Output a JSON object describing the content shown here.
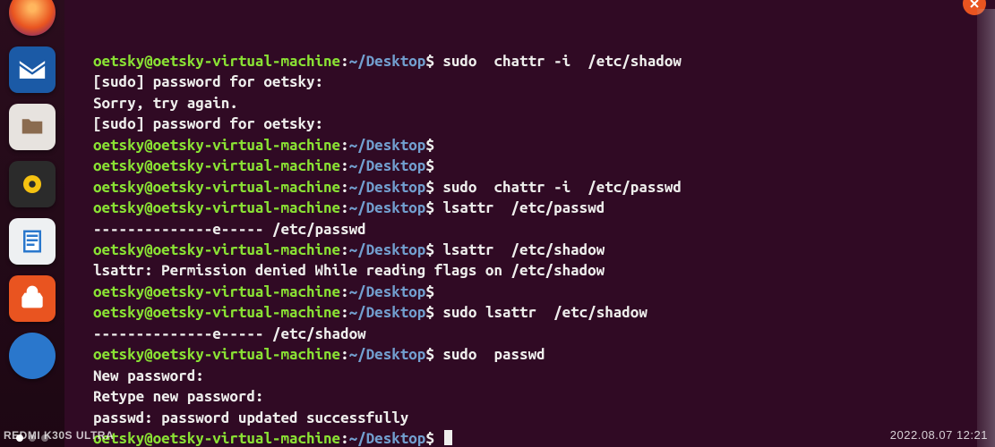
{
  "dock": {
    "items": [
      {
        "name": "firefox",
        "bg": "#e95420"
      },
      {
        "name": "thunderbird",
        "bg": "#1b5aa6"
      },
      {
        "name": "files",
        "bg": "#e7e3df"
      },
      {
        "name": "rhythmbox",
        "bg": "#2b2b2b"
      },
      {
        "name": "libreoffice-writer",
        "bg": "#eef0f2"
      },
      {
        "name": "ubuntu-software",
        "bg": "#e95420"
      },
      {
        "name": "help",
        "bg": "#2a77cc"
      }
    ]
  },
  "prompt": {
    "user_host": "oetsky@oetsky-virtual-machine",
    "colon": ":",
    "path": "~/Desktop",
    "dollar": "$"
  },
  "lines": [
    {
      "type": "prompt",
      "cmd": " sudo  chattr -i  /etc/shadow"
    },
    {
      "type": "out",
      "text": "[sudo] password for oetsky:"
    },
    {
      "type": "out",
      "text": "Sorry, try again."
    },
    {
      "type": "out",
      "text": "[sudo] password for oetsky:"
    },
    {
      "type": "prompt",
      "cmd": ""
    },
    {
      "type": "prompt",
      "cmd": ""
    },
    {
      "type": "prompt",
      "cmd": " sudo  chattr -i  /etc/passwd"
    },
    {
      "type": "prompt",
      "cmd": " lsattr  /etc/passwd"
    },
    {
      "type": "out",
      "text": "--------------e----- /etc/passwd"
    },
    {
      "type": "prompt",
      "cmd": " lsattr  /etc/shadow"
    },
    {
      "type": "out",
      "text": "lsattr: Permission denied While reading flags on /etc/shadow"
    },
    {
      "type": "prompt",
      "cmd": ""
    },
    {
      "type": "prompt",
      "cmd": " sudo lsattr  /etc/shadow"
    },
    {
      "type": "out",
      "text": "--------------e----- /etc/shadow"
    },
    {
      "type": "prompt",
      "cmd": " sudo  passwd"
    },
    {
      "type": "out",
      "text": "New password:"
    },
    {
      "type": "out",
      "text": "Retype new password:"
    },
    {
      "type": "out",
      "text": "passwd: password updated successfully"
    },
    {
      "type": "prompt",
      "cmd": " ",
      "cursor": true
    }
  ],
  "watermark": "REDMI K30S ULTRA",
  "timestamp": "2022.08.07  12:21"
}
